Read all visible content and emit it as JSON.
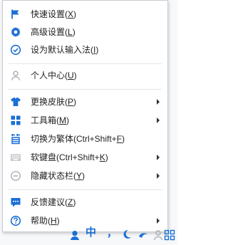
{
  "menu": {
    "items": [
      {
        "label": "快速设置(",
        "key": "X",
        "tail": ")",
        "icon": "flag-icon",
        "submenu": false
      },
      {
        "label": "高级设置(",
        "key": "L",
        "tail": ")",
        "icon": "gear-icon",
        "submenu": false
      },
      {
        "label": "设为默认输入法(",
        "key": "I",
        "tail": ")",
        "icon": "check-circle-icon",
        "submenu": false
      },
      {
        "label": "个人中心(",
        "key": "U",
        "tail": ")",
        "icon": "user-icon",
        "submenu": false
      },
      {
        "label": "更换皮肤(",
        "key": "P",
        "tail": ")",
        "icon": "shirt-icon",
        "submenu": true
      },
      {
        "label": "工具箱(",
        "key": "M",
        "tail": ")",
        "icon": "toolbox-icon",
        "submenu": true
      },
      {
        "label": "切换为繁体(Ctrl+Shift+",
        "key": "F",
        "tail": ")",
        "icon": "traditional-char-icon",
        "submenu": false
      },
      {
        "label": "软键盘(Ctrl+Shift+",
        "key": "K",
        "tail": ")",
        "icon": "keyboard-icon",
        "submenu": true
      },
      {
        "label": "隐藏状态栏(",
        "key": "Y",
        "tail": ")",
        "icon": "minus-circle-icon",
        "submenu": true
      },
      {
        "label": "反馈建议(",
        "key": "Z",
        "tail": ")",
        "icon": "chat-bubble-icon",
        "submenu": false
      },
      {
        "label": "帮助(",
        "key": "H",
        "tail": ")",
        "icon": "help-icon",
        "submenu": true
      }
    ],
    "icon_color": "#1a6fd6",
    "disabled_icon_color": "#a9adb3"
  },
  "taskbar": {
    "ime_mode": "中",
    "punctuation": "，"
  }
}
